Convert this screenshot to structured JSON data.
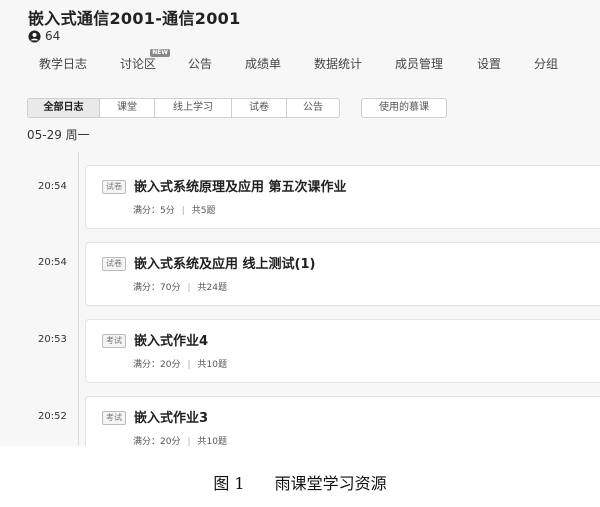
{
  "course": {
    "title": "嵌入式通信2001-通信2001",
    "member_count": "64"
  },
  "nav": {
    "tabs": [
      {
        "label": "教学日志"
      },
      {
        "label": "讨论区",
        "badge": "NEW"
      },
      {
        "label": "公告"
      },
      {
        "label": "成绩单"
      },
      {
        "label": "数据统计"
      },
      {
        "label": "成员管理"
      },
      {
        "label": "设置"
      },
      {
        "label": "分组"
      }
    ]
  },
  "filters": {
    "chips": [
      "全部日志",
      "课堂",
      "线上学习",
      "试卷",
      "公告"
    ],
    "active": "全部日志",
    "moc_label": "使用的慕课"
  },
  "date_heading": "05-29 周一",
  "entries": [
    {
      "time": "20:54",
      "type": "试卷",
      "title": "嵌入式系统原理及应用 第五次课作业",
      "score": "满分：5分",
      "count": "共5题"
    },
    {
      "time": "20:54",
      "type": "试卷",
      "title": "嵌入式系统及应用 线上测试(1)",
      "score": "满分：70分",
      "count": "共24题"
    },
    {
      "time": "20:53",
      "type": "考试",
      "title": "嵌入式作业4",
      "score": "满分：20分",
      "count": "共10题"
    },
    {
      "time": "20:52",
      "type": "考试",
      "title": "嵌入式作业3",
      "score": "满分：20分",
      "count": "共10题"
    }
  ],
  "caption": {
    "figure_no": "图 1",
    "text": "雨课堂学习资源"
  }
}
